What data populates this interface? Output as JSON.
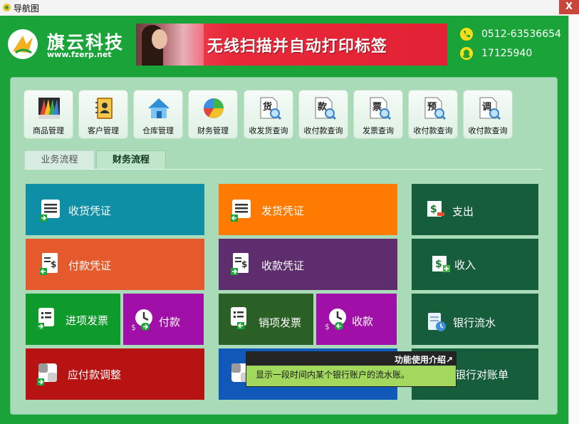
{
  "window": {
    "title": "导航图",
    "close_label": "X"
  },
  "brand": {
    "name": "旗云科技",
    "url": "www.fzerp.net"
  },
  "banner": {
    "text": "无线扫描并自动打印标签"
  },
  "contact": {
    "phone": "0512-63536654",
    "qq": "17125940"
  },
  "quick_buttons": [
    {
      "label": "商品管理",
      "icon": "product-stack-icon"
    },
    {
      "label": "客户管理",
      "icon": "contact-book-icon"
    },
    {
      "label": "仓库管理",
      "icon": "warehouse-house-icon"
    },
    {
      "label": "财务管理",
      "icon": "pie-chart-icon"
    },
    {
      "label": "收发货查询",
      "icon": "doc-search-icon",
      "glyph": "货"
    },
    {
      "label": "收付款查询",
      "icon": "doc-search-icon",
      "glyph": "款"
    },
    {
      "label": "发票查询",
      "icon": "doc-search-icon",
      "glyph": "票"
    },
    {
      "label": "收付款查询",
      "icon": "doc-search-icon",
      "glyph": "预"
    },
    {
      "label": "收付款查询",
      "icon": "doc-search-icon",
      "glyph": "调"
    }
  ],
  "tabs": {
    "business": "业务流程",
    "finance": "财务流程",
    "active": "finance"
  },
  "tiles": {
    "receive_voucher": "收货凭证",
    "ship_voucher": "发货凭证",
    "expense": "支出",
    "payment_voucher": "付款凭证",
    "receipt_voucher": "收款凭证",
    "income": "收入",
    "purchase_invoice": "进项发票",
    "payment": "付款",
    "sales_invoice": "销项发票",
    "collection": "收款",
    "bank_flow": "银行流水",
    "payable_adjust": "应付款调整",
    "bank_statement": "银行对账单"
  },
  "tooltip": {
    "title": "功能使用介绍↗",
    "body": "显示一段时间内某个银行账户的流水账。"
  },
  "colors": {
    "frame": "#1aa338",
    "panel": "#a9dbb9",
    "teal": "#0e8fa5",
    "orange": "#ff7a00",
    "dark_green": "#155d3b",
    "red_orange": "#e45a2c",
    "purple": "#5e2d6e",
    "green": "#0f9a2c",
    "magenta": "#a00fa8",
    "deep_green": "#2a5f25",
    "crimson": "#b71313",
    "blue": "#1059b8"
  }
}
